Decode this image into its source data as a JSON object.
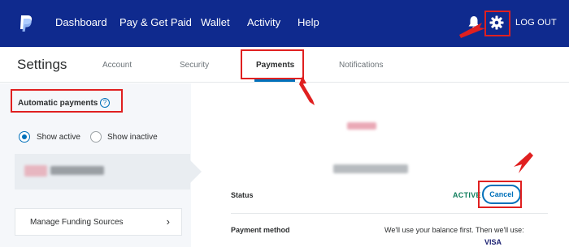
{
  "topbar": {
    "nav": [
      "Dashboard",
      "Pay & Get Paid",
      "Wallet",
      "Activity",
      "Help"
    ],
    "logout": "LOG OUT",
    "icons": {
      "logo": "paypal-logo",
      "bell": "bell-icon",
      "gear": "gear-icon"
    }
  },
  "settings": {
    "title": "Settings",
    "tabs": [
      "Account",
      "Security",
      "Payments",
      "Notifications"
    ],
    "active_tab": "Payments"
  },
  "left": {
    "title": "Automatic payments",
    "help_glyph": "?",
    "radio_active": "Show active",
    "radio_inactive": "Show inactive",
    "selected": "Show active",
    "manage_label": "Manage Funding Sources",
    "manage_chevron": "›"
  },
  "detail": {
    "status_label": "Status",
    "status_value": "ACTIVE",
    "cancel_label": "Cancel",
    "payment_method_label": "Payment method",
    "payment_method_value": "We'll use your balance first. Then we'll use:",
    "card_brand": "VISA"
  },
  "colors": {
    "nav_bg": "#0f2a8e",
    "accent": "#0070ba",
    "active_status": "#0f7d5c",
    "annotation": "#e02020"
  }
}
